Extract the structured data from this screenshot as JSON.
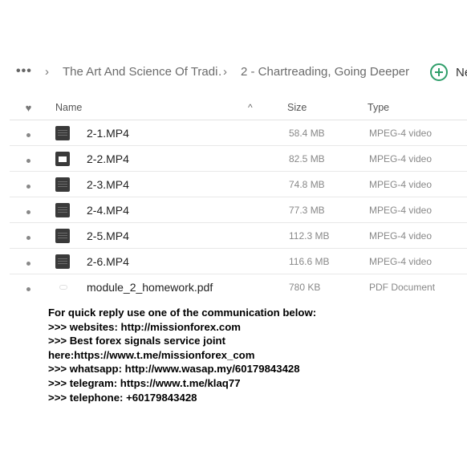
{
  "breadcrumb": {
    "more": "•••",
    "separator": "›",
    "items": [
      "The Art And Science Of Tradi…",
      "2 - Chartreading, Going Deeper"
    ]
  },
  "new_button": {
    "label": "Ne",
    "icon": "plus-circle-icon"
  },
  "table": {
    "headers": {
      "favorite": "♥",
      "name": "Name",
      "sort": "^",
      "size": "Size",
      "type": "Type"
    },
    "rows": [
      {
        "name": "2-1.MP4",
        "size": "58.4 MB",
        "type": "MPEG-4 video",
        "icon": "video-file-icon"
      },
      {
        "name": "2-2.MP4",
        "size": "82.5 MB",
        "type": "MPEG-4 video",
        "icon": "video-file-icon"
      },
      {
        "name": "2-3.MP4",
        "size": "74.8 MB",
        "type": "MPEG-4 video",
        "icon": "video-file-icon"
      },
      {
        "name": "2-4.MP4",
        "size": "77.3 MB",
        "type": "MPEG-4 video",
        "icon": "video-file-icon"
      },
      {
        "name": "2-5.MP4",
        "size": "112.3 MB",
        "type": "MPEG-4 video",
        "icon": "video-file-icon"
      },
      {
        "name": "2-6.MP4",
        "size": "116.6 MB",
        "type": "MPEG-4 video",
        "icon": "video-file-icon"
      },
      {
        "name": "module_2_homework.pdf",
        "size": "780 KB",
        "type": "PDF Document",
        "icon": "pdf-file-icon"
      }
    ]
  },
  "contact": {
    "lines": [
      "For quick reply use one of the communication below:",
      ">>> websites: http://missionforex.com",
      ">>> Best forex signals service joint",
      "here:https://www.t.me/missionforex_com",
      ">>> whatsapp: http://www.wasap.my/60179843428",
      ">>> telegram: https://www.t.me/klaq77",
      ">>> telephone: +60179843428"
    ]
  },
  "colors": {
    "accent": "#2f9e6a",
    "icon_dark": "#3a3a3a"
  }
}
